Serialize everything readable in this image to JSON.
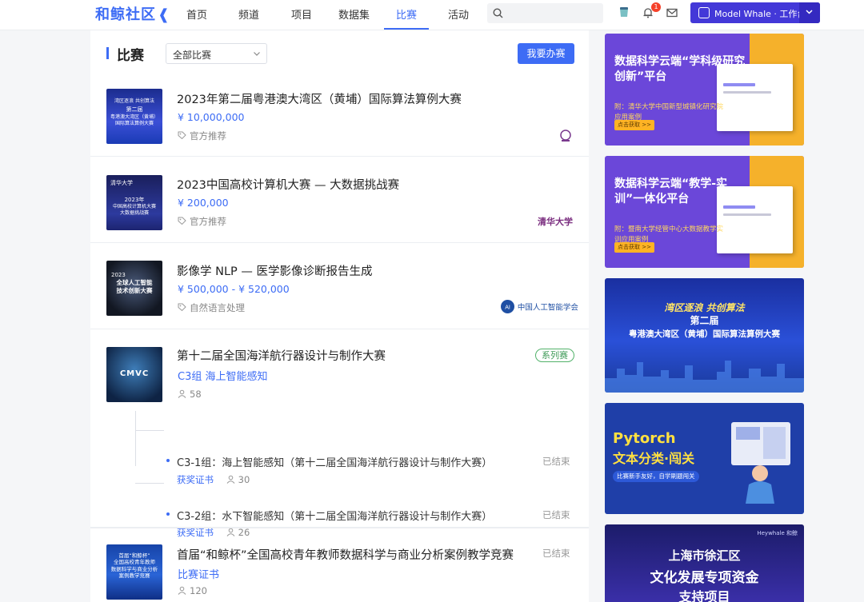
{
  "brand": {
    "name": "和鲸社区"
  },
  "nav": [
    {
      "label": "首页"
    },
    {
      "label": "频道"
    },
    {
      "label": "项目"
    },
    {
      "label": "数据集"
    },
    {
      "label": "比赛"
    },
    {
      "label": "活动"
    }
  ],
  "search": {
    "placeholder": ""
  },
  "notifications": {
    "count": "1"
  },
  "workbench": {
    "label": "Model Whale · 工作台"
  },
  "page": {
    "section_title": "比赛",
    "filter_selected": "全部比赛",
    "host_button": "我要办赛"
  },
  "competitions": [
    {
      "title": "2023年第二届粤港澳大湾区（黄埔）国际算法算例大赛",
      "prize": "¥ 10,000,000",
      "tag": "官方推荐",
      "thumb": {
        "l1": "湾区逐浪 共创算法",
        "l2": "第二届",
        "l3": "粤港澳大湾区（黄埔）",
        "l4": "国际算法算例大赛"
      }
    },
    {
      "title": "2023中国高校计算机大赛 — 大数据挑战赛",
      "prize": "¥ 200,000",
      "tag": "官方推荐",
      "org": "清华大学",
      "thumb": {
        "l1": "清华大学",
        "l2": "2023年",
        "l3": "中国高校计算机大赛",
        "l4": "大数据挑战赛"
      }
    },
    {
      "title": "影像学 NLP — 医学影像诊断报告生成",
      "prize": "¥ 500,000 - ¥ 520,000",
      "tag": "自然语言处理",
      "org": "中国人工智能学会",
      "thumb": {
        "l1": "2023",
        "l2": "全球人工智能",
        "l3": "技术创新大赛"
      }
    },
    {
      "title": "第十二届全国海洋航行器设计与制作大赛",
      "subtitle": "C3组 海上智能感知",
      "count": "58",
      "badge": "系列赛",
      "thumb": {
        "l1": "CMVC"
      },
      "subs": [
        {
          "title": "C3-1组：海上智能感知（第十二届全国海洋航行器设计与制作大赛）",
          "status": "已结束",
          "cert": "获奖证书",
          "count": "30"
        },
        {
          "title": "C3-2组：水下智能感知（第十二届全国海洋航行器设计与制作大赛）",
          "status": "已结束",
          "cert": "获奖证书",
          "count": "26"
        }
      ]
    },
    {
      "title": "首届“和鲸杯”全国高校青年教师数据科学与商业分析案例教学竞赛",
      "subtitle": "比赛证书",
      "count": "120",
      "status": "已结束",
      "thumb": {
        "l1": "首届“和鲸杯”",
        "l2": "全国高校青年教师",
        "l3": "数据科学与商业分析",
        "l4": "案例教学竞赛"
      }
    }
  ],
  "banners": [
    {
      "title": "数据科学云端“学科级研究创新”平台",
      "sub": "附：清华大学中国新型城镇化研究院应用案例",
      "btn": "点击获取 >>"
    },
    {
      "title": "数据科学云端“教学-实训”一体化平台",
      "sub": "附：暨南大学经管中心大数据教学实训应用案例",
      "btn": "点击获取 >>"
    },
    {
      "l1": "湾区逐浪  共创算法",
      "l2": "第二届",
      "l3": "粤港澳大湾区（黄埔）国际算法算例大赛"
    },
    {
      "l1": "Pytorch",
      "l2": "文本分类·闯关",
      "l3": "比赛新手友好，自学刷题闯关"
    },
    {
      "brand": "Heywhale 和鲸",
      "l1": "上海市徐汇区",
      "l2": "文化发展专项资金",
      "l3": "支持项目"
    }
  ],
  "colors": {
    "accent": "#3d6cf5",
    "workbench": "#4338d8",
    "badge": "#f5412a",
    "series_tag": "#52b26a"
  }
}
